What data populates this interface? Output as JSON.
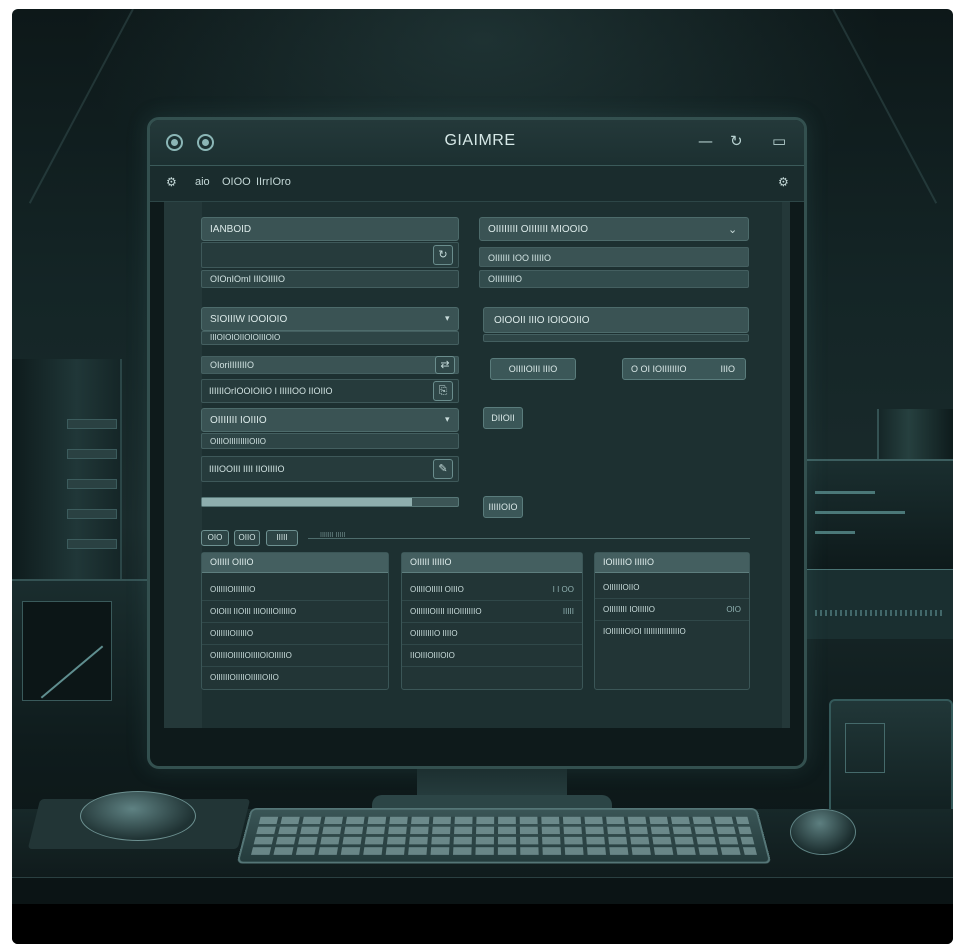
{
  "window": {
    "title": "GIAIMRE",
    "controls": {
      "minimize": "—",
      "refresh": "↻",
      "expand": "▭"
    }
  },
  "menubar": {
    "items": [
      "aio",
      "OIOO",
      "IIrrIOro"
    ],
    "icon_left": "gear-icon",
    "icon_right": "settings-icon"
  },
  "left_column": {
    "panel1": {
      "header": "IANBOID",
      "footer": "OIOnIOmI IIIOIIIIO"
    },
    "panel2": {
      "header": "SIOIIIW IOOIOIO",
      "line": "IIIOIOIOIIOIOIIIOIO"
    },
    "row1": {
      "label": "OIoriIIIIIIIO"
    },
    "row2": {
      "label": "IIIIIIOrIOOIOIIO I IIIIIOO IIOIIO"
    },
    "panel3": {
      "header": "OIIIIIII IOIIIO",
      "line": "OIIIOIIIIIIIIIOIIO"
    },
    "row3": {
      "label": "IIIIOOIII IIII IIOIIIIO"
    }
  },
  "right_column": {
    "panel1": {
      "header": "OIIIIIIII OIIIIIII MIOOIO",
      "line1": "OIIIIII IOO IIIIIO",
      "line2": "OIIIIIIIIO"
    },
    "panel2": {
      "header": "OIOOII IIIO IOIOOIIO"
    },
    "buttons": {
      "b1": "OIIIIOIII IIIO",
      "b2": "O OI IOIIIIIIIO",
      "b2_suffix": "IIIO"
    },
    "btn_small1": "DIIOII",
    "btn_small2": "IIIIIOIO"
  },
  "progress": {
    "value": 0.82
  },
  "tabs": {
    "items": [
      "OIO",
      "OIIO",
      "IIIII"
    ],
    "note": "IIIIIII IIIII"
  },
  "table_columns": [
    {
      "header": "OIIIII OIIIO",
      "rows": [
        {
          "label": "OIIIIIOIIIIIIIO",
          "value": ""
        },
        {
          "label": "OIOIII IIOIII IIIOIIIOIIIIIO",
          "value": ""
        },
        {
          "label": "OIIIIIIOIIIIIO",
          "value": ""
        },
        {
          "label": "OIIIIIOIIIIIOIIIIOIOIIIIIO",
          "value": ""
        },
        {
          "label": "OIIIIIIOIIIIOIIIIIOIIO",
          "value": ""
        }
      ]
    },
    {
      "header": "OIIIII IIIIIO",
      "rows": [
        {
          "label": "OIIIIOIIIII OIIIO",
          "value": "I I OO"
        },
        {
          "label": "OIIIIIIOIIII IIIOIIIIIIIO",
          "value": "IIIII"
        },
        {
          "label": "OIIIIIIIIO IIIIO",
          "value": ""
        },
        {
          "label": "IIOIIIOIIIOIO",
          "value": ""
        }
      ]
    },
    {
      "header": "IOIIIIIO IIIIIO",
      "rows": [
        {
          "label": "OIIIIIIOIIO",
          "value": ""
        },
        {
          "label": "OIIIIIIII IOIIIIIO",
          "value": "OIO"
        },
        {
          "label": "IOIIIIIIOIOI IIIIIIIIIIIIIIIIO",
          "value": ""
        }
      ]
    }
  ]
}
